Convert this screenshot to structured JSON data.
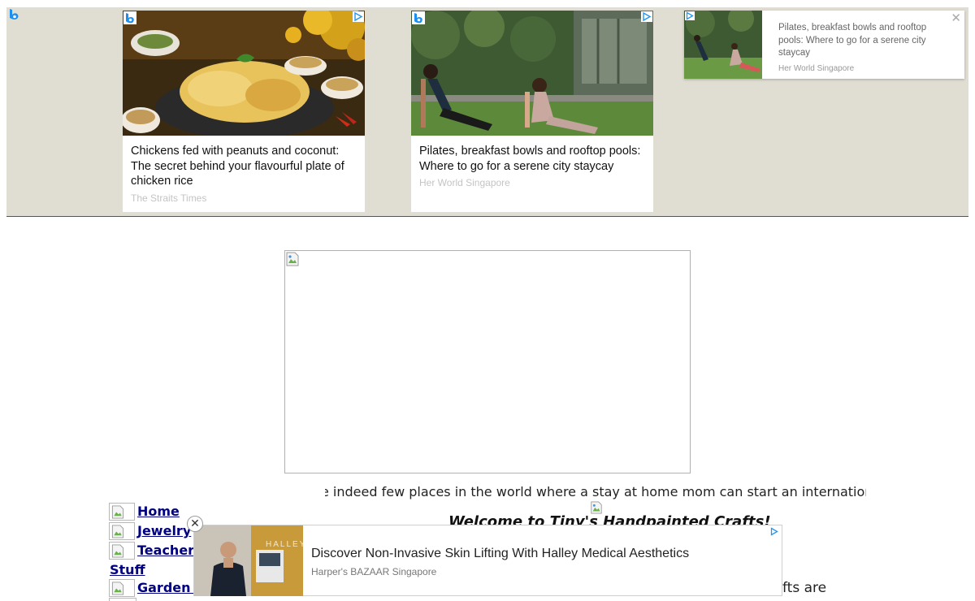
{
  "ad_strip": {
    "cards": [
      {
        "title": "Chickens fed with peanuts and coconut: The secret behind your flavourful plate of chicken rice",
        "source": "The Straits Times",
        "image": "chicken-rice-photo"
      },
      {
        "title": "Pilates, breakfast bowls and rooftop pools: Where to go for a serene city staycay",
        "source": "Her World Singapore",
        "image": "pilates-photo"
      }
    ],
    "mini_card": {
      "title": "Pilates, breakfast bowls and rooftop pools: Where to go for a serene city staycay",
      "source": "Her World Singapore",
      "close_label": "✕"
    }
  },
  "page": {
    "marquee_text": "e indeed few places in the world where a stay at home mom can start an international b",
    "welcome_text": "Welcome to Tiny's Handpainted Crafts!",
    "trailing_text": "fts are",
    "nav": [
      {
        "label": "Home"
      },
      {
        "label": "Jewelry"
      },
      {
        "label": "Teacher"
      },
      {
        "label": "Garden S"
      }
    ],
    "nav_wrap_label": "Stuff"
  },
  "bottom_ad": {
    "title": "Discover Non-Invasive Skin Lifting With Halley Medical Aesthetics",
    "source": "Harper's BAZAAR Singapore",
    "close_label": "✕",
    "brand_in_image": "HALLEY"
  },
  "colors": {
    "strip_background": "#e0ddd2",
    "link": "#000080",
    "adchoices": "#2196f3"
  }
}
